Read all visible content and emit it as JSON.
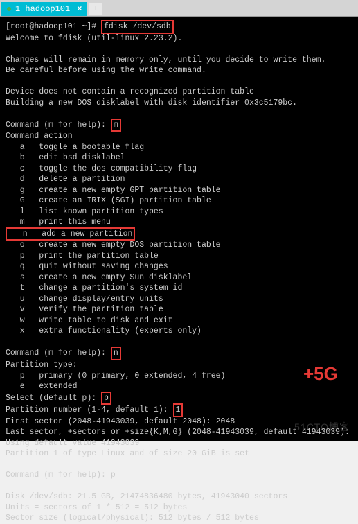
{
  "tab": {
    "label": "1 hadoop101",
    "close": "×",
    "new": "+"
  },
  "prompt": "[root@hadoop101 ~]#",
  "cmd_fdisk": "fdisk /dev/sdb",
  "welcome": "Welcome to fdisk (util-linux 2.23.2).",
  "blank": "",
  "mem_warn": "Changes will remain in memory only, until you decide to write them.",
  "careful": "Be careful before using the write command.",
  "no_table": "Device does not contain a recognized partition table",
  "building": "Building a new DOS disklabel with disk identifier 0x3c5179bc.",
  "cmd_help": "Command (m for help):",
  "m_input": "m",
  "action_hdr": "Command action",
  "act_a": "   a   toggle a bootable flag",
  "act_b": "   b   edit bsd disklabel",
  "act_c": "   c   toggle the dos compatibility flag",
  "act_d": "   d   delete a partition",
  "act_g": "   g   create a new empty GPT partition table",
  "act_G": "   G   create an IRIX (SGI) partition table",
  "act_l": "   l   list known partition types",
  "act_m": "   m   print this menu",
  "act_n": "   n   add a new partition",
  "act_o": "   o   create a new empty DOS partition table",
  "act_p": "   p   print the partition table",
  "act_q": "   q   quit without saving changes",
  "act_s": "   s   create a new empty Sun disklabel",
  "act_t": "   t   change a partition's system id",
  "act_u": "   u   change display/entry units",
  "act_v": "   v   verify the partition table",
  "act_w": "   w   write table to disk and exit",
  "act_x": "   x   extra functionality (experts only)",
  "n_input": "n",
  "ptype_hdr": "Partition type:",
  "ptype_p": "   p   primary (0 primary, 0 extended, 4 free)",
  "ptype_e": "   e   extended",
  "select_p": "Select (default p):",
  "p_input": "p",
  "pnum": "Partition number (1-4, default 1):",
  "one_input": "1",
  "first_sector": "First sector (2048-41943039, default 2048): 2048",
  "last_sector": "Last sector, +sectors or +size{K,M,G} (2048-41943039, default 41943039): ",
  "using_default": "Using default value 41943039",
  "part_set": "Partition 1 of type Linux and of size 20 GiB is set",
  "p_cmd": "Command (m for help): p",
  "disk_info": "Disk /dev/sdb: 21.5 GB, 21474836480 bytes, 41943040 sectors",
  "units": "Units = sectors of 1 * 512 = 512 bytes",
  "sector_size": "Sector size (logical/physical): 512 bytes / 512 bytes",
  "annotation": "+5G",
  "watermark": "51CTO博客"
}
